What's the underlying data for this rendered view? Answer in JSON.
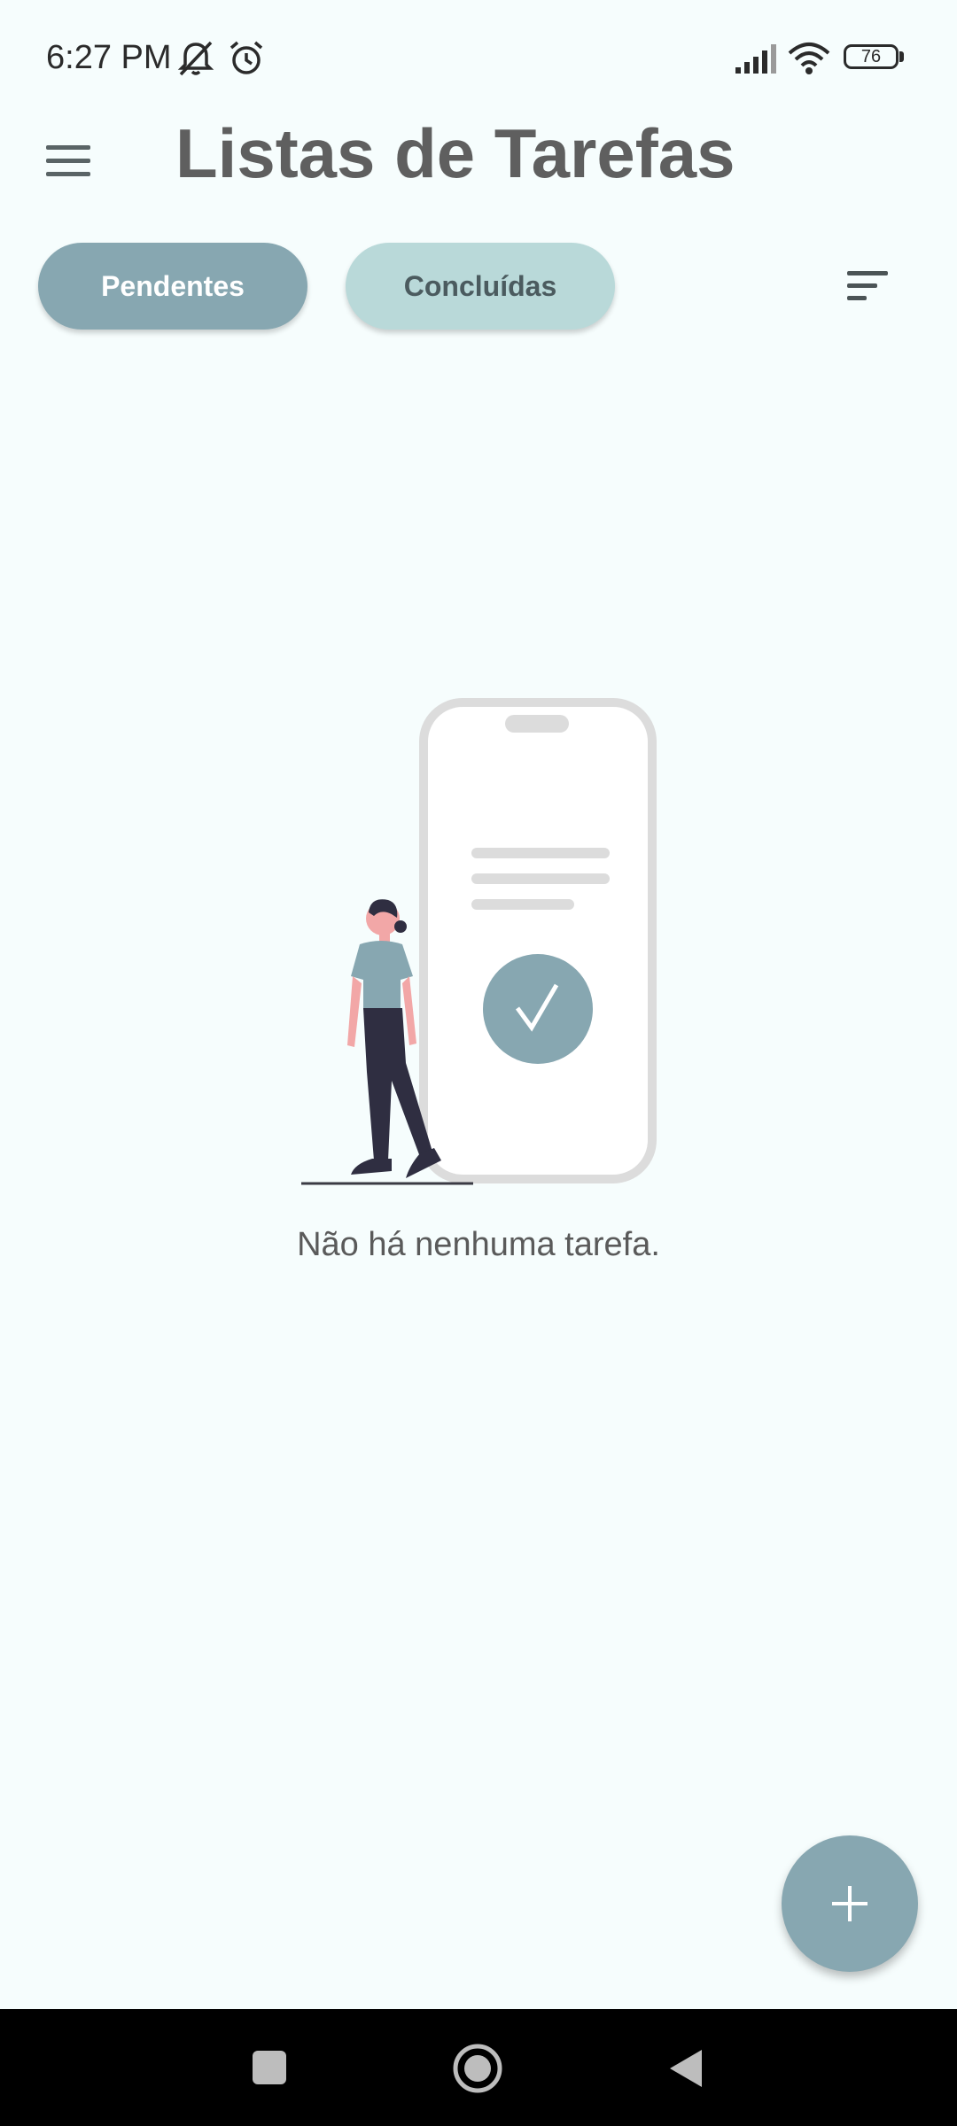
{
  "status_bar": {
    "time": "6:27 PM",
    "battery_level": "76",
    "icons": [
      "notifications-off-icon",
      "alarm-icon",
      "signal-icon",
      "wifi-icon",
      "battery-icon"
    ]
  },
  "header": {
    "menu_icon": "hamburger-menu-icon",
    "title": "Listas de Tarefas"
  },
  "tabs": [
    {
      "label": "Pendentes",
      "selected": true
    },
    {
      "label": "Concluídas",
      "selected": false
    }
  ],
  "sort_icon": "sort-icon",
  "empty_state": {
    "illustration": "person-with-phone-checkmark-illustration",
    "message": "Não há nenhuma tarefa."
  },
  "fab": {
    "icon": "add-icon"
  },
  "nav_bar": {
    "buttons": [
      "recents-square-icon",
      "home-circle-icon",
      "back-triangle-icon"
    ]
  },
  "colors": {
    "background": "#f6fdfd",
    "accent": "#87a7b1",
    "tab_inactive": "#b9d9d9",
    "title_text": "#5f5f5f"
  }
}
